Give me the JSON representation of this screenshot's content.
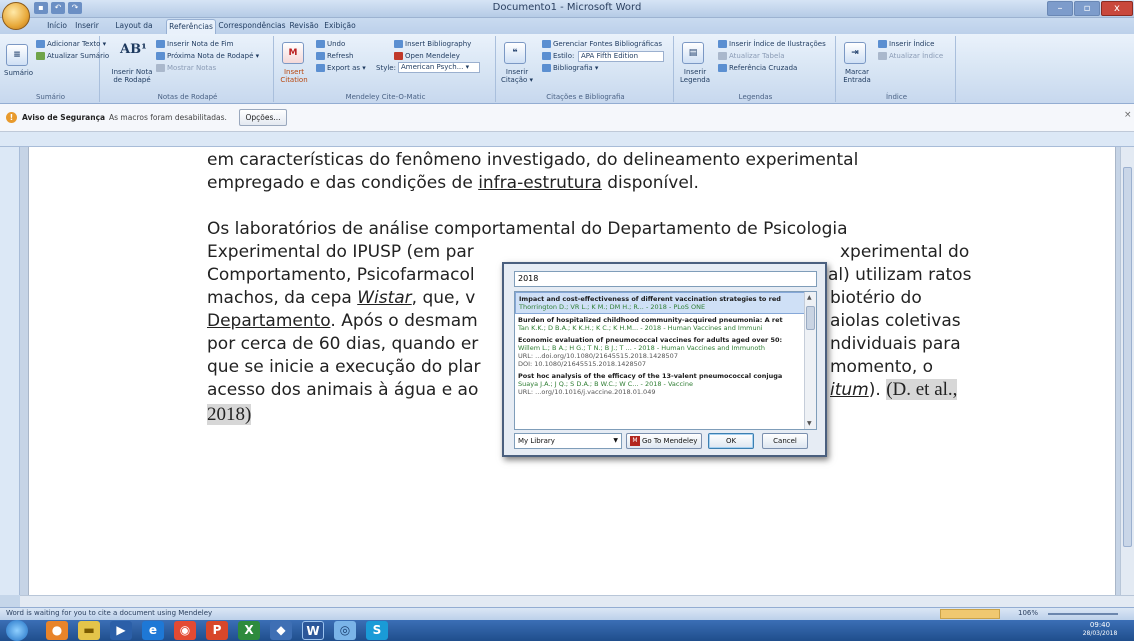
{
  "window": {
    "title": "Documento1 - Microsoft Word",
    "min": "–",
    "max": "▫",
    "close": "x"
  },
  "tabs": [
    "Início",
    "Inserir",
    "Layout da Página",
    "Referências",
    "Correspondências",
    "Revisão",
    "Exibição"
  ],
  "active_tab": "Referências",
  "ribbon": {
    "sumario": {
      "label": "Sumário",
      "add_text": "Adicionar Texto ▾",
      "update": "Atualizar Sumário",
      "group": "Sumário"
    },
    "notas": {
      "insert_footnote": "Inserir Nota de Rodapé",
      "insert_endnote": "Inserir Nota de Fim",
      "next_footnote": "Próxima Nota de Rodapé ▾",
      "show_notes": "Mostrar Notas",
      "group": "Notas de Rodapé",
      "ab_icon": "AB¹"
    },
    "mendeley": {
      "undo": "Undo",
      "refresh": "Refresh",
      "export": "Export as ▾",
      "insert_bib": "Insert Bibliography",
      "open": "Open Mendeley",
      "style_label": "Style:",
      "style_value": "American Psych... ▾",
      "insert_citation": "Insert Citation",
      "group": "Mendeley Cite-O-Matic"
    },
    "citacoes": {
      "insert_citation": "Inserir Citação ▾",
      "manage": "Gerenciar Fontes Bibliográficas",
      "style_label": "Estilo:",
      "style_value": "APA Fifth Edition",
      "bibliography": "Bibliografia ▾",
      "group": "Citações e Bibliografia"
    },
    "legendas": {
      "insert_caption": "Inserir Legenda",
      "insert_table": "Inserir Índice de Ilustrações",
      "update_table": "Atualizar Tabela",
      "cross_ref": "Referência Cruzada",
      "group": "Legendas"
    },
    "indice": {
      "mark_entry": "Marcar Entrada",
      "insert_index": "Inserir Índice",
      "update_index": "Atualizar Índice",
      "group": "Índice"
    }
  },
  "security": {
    "label": "Aviso de Segurança",
    "message": "As macros foram desabilitadas.",
    "options": "Opções..."
  },
  "document": {
    "line1": "em características do fenômeno investigado, do delineamento experimental",
    "line2a": "empregado e das condições de ",
    "line2b": "infra-estrutura",
    "line2c": " disponível.",
    "p2_line1": "Os laboratórios de análise comportamental do Departamento de Psicologia",
    "p2_line2a": "Experimental do IPUSP (em par",
    "p2_line2b": "xperimental do",
    "p2_line3a": "Comportamento, Psicofarmacol",
    "p2_line3b": "al) utilizam ratos",
    "p2_line4a": "machos, da cepa ",
    "p2_line4b": "Wistar",
    "p2_line4c": ", que, v",
    "p2_line4d": "biotério do",
    "p2_line5a": "Departamento",
    "p2_line5b": ". Após o desmam",
    "p2_line5c": "aiolas coletivas",
    "p2_line6a": "por cerca de 60 dias, quando er",
    "p2_line6b": "ndividuais para",
    "p2_line7a": "que se inicie a execução do plar",
    "p2_line7b": "momento, o",
    "p2_line8a": "acesso dos animais à água e ao",
    "p2_line8b": "itum",
    "p2_line8c": "). ",
    "citation_part1": "(D. et al.,",
    "citation_part2": "2018)"
  },
  "dialog": {
    "search": "2018",
    "results": [
      {
        "title": "Impact and cost-effectiveness of different vaccination strategies to red",
        "meta": "Thorrington D.; VR L.; K M.; DM H.; R... - 2018 - PLoS ONE"
      },
      {
        "title": "Burden of hospitalized childhood community-acquired pneumonia: A ret",
        "meta": "Tan K.K.; D B.A.; K K.H.; K C.; K H.M... - 2018 - Human Vaccines and Immuni"
      },
      {
        "title": "Economic evaluation of pneumococcal vaccines for adults aged over 50:",
        "meta": "Willem L.; B A.; H G.; T N.; B J.; T ... - 2018 - Human Vaccines and Immunoth",
        "url": "URL: ...doi.org/10.1080/21645515.2018.1428507",
        "doi": "DOI: 10.1080/21645515.2018.1428507"
      },
      {
        "title": "Post hoc analysis of the efficacy of the 13-valent pneumococcal conjuga",
        "meta": "Suaya J.A.; J Q.; S D.A.; B W.C.; W C... - 2018 - Vaccine",
        "url": "URL: ...org/10.1016/j.vaccine.2018.01.049"
      }
    ],
    "library": "My Library",
    "goto": "Go To Mendeley",
    "ok": "OK",
    "cancel": "Cancel"
  },
  "status": {
    "message": "Word is waiting for you to cite a document using Mendeley",
    "zoom": "106%"
  },
  "taskbar": {
    "time": "09:40",
    "date": "28/03/2018"
  }
}
